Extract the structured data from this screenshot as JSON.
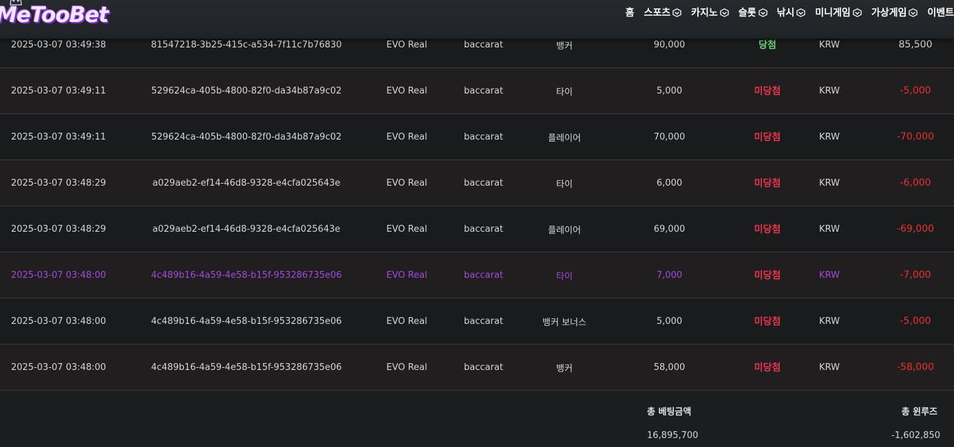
{
  "header": {
    "logo": "MeTooBet",
    "nav": [
      {
        "label": "홈",
        "dropdown": false
      },
      {
        "label": "스포츠",
        "dropdown": true
      },
      {
        "label": "카지노",
        "dropdown": true
      },
      {
        "label": "슬롯",
        "dropdown": true
      },
      {
        "label": "낚시",
        "dropdown": true
      },
      {
        "label": "미니게임",
        "dropdown": true
      },
      {
        "label": "가상게임",
        "dropdown": true
      },
      {
        "label": "이벤트",
        "dropdown": false
      }
    ]
  },
  "bets": [
    {
      "date": "2025-03-07 03:49:38",
      "id": "81547218-3b25-415c-a534-7f11c7b76830",
      "provider": "EVO Real",
      "game": "baccarat",
      "pick": "뱅커",
      "bet": "90,000",
      "result": "당첨",
      "result_type": "win",
      "currency": "KRW",
      "winloss": "85,500"
    },
    {
      "date": "2025-03-07 03:49:11",
      "id": "529624ca-405b-4800-82f0-da34b87a9c02",
      "provider": "EVO Real",
      "game": "baccarat",
      "pick": "타이",
      "bet": "5,000",
      "result": "미당첨",
      "result_type": "lose",
      "currency": "KRW",
      "winloss": "-5,000"
    },
    {
      "date": "2025-03-07 03:49:11",
      "id": "529624ca-405b-4800-82f0-da34b87a9c02",
      "provider": "EVO Real",
      "game": "baccarat",
      "pick": "플레이어",
      "bet": "70,000",
      "result": "미당첨",
      "result_type": "lose",
      "currency": "KRW",
      "winloss": "-70,000"
    },
    {
      "date": "2025-03-07 03:48:29",
      "id": "a029aeb2-ef14-46d8-9328-e4cfa025643e",
      "provider": "EVO Real",
      "game": "baccarat",
      "pick": "타이",
      "bet": "6,000",
      "result": "미당첨",
      "result_type": "lose",
      "currency": "KRW",
      "winloss": "-6,000"
    },
    {
      "date": "2025-03-07 03:48:29",
      "id": "a029aeb2-ef14-46d8-9328-e4cfa025643e",
      "provider": "EVO Real",
      "game": "baccarat",
      "pick": "플레이어",
      "bet": "69,000",
      "result": "미당첨",
      "result_type": "lose",
      "currency": "KRW",
      "winloss": "-69,000"
    },
    {
      "date": "2025-03-07 03:48:00",
      "id": "4c489b16-4a59-4e58-b15f-953286735e06",
      "provider": "EVO Real",
      "game": "baccarat",
      "pick": "타이",
      "bet": "7,000",
      "result": "미당첨",
      "result_type": "lose",
      "currency": "KRW",
      "winloss": "-7,000",
      "highlight": true
    },
    {
      "date": "2025-03-07 03:48:00",
      "id": "4c489b16-4a59-4e58-b15f-953286735e06",
      "provider": "EVO Real",
      "game": "baccarat",
      "pick": "뱅커 보너스",
      "bet": "5,000",
      "result": "미당첨",
      "result_type": "lose",
      "currency": "KRW",
      "winloss": "-5,000"
    },
    {
      "date": "2025-03-07 03:48:00",
      "id": "4c489b16-4a59-4e58-b15f-953286735e06",
      "provider": "EVO Real",
      "game": "baccarat",
      "pick": "뱅커",
      "bet": "58,000",
      "result": "미당첨",
      "result_type": "lose",
      "currency": "KRW",
      "winloss": "-58,000"
    }
  ],
  "totals": {
    "bet_label": "총 베팅금액",
    "bet_value": "16,895,700",
    "winloss_label": "총 윈루즈",
    "winloss_value": "-1,602,850"
  },
  "colors": {
    "win": "#67d76a",
    "lose": "#e8344c",
    "negative_amount": "#ee3030",
    "highlight_row_text": "#a24ae0",
    "logo": "#b46cff"
  }
}
